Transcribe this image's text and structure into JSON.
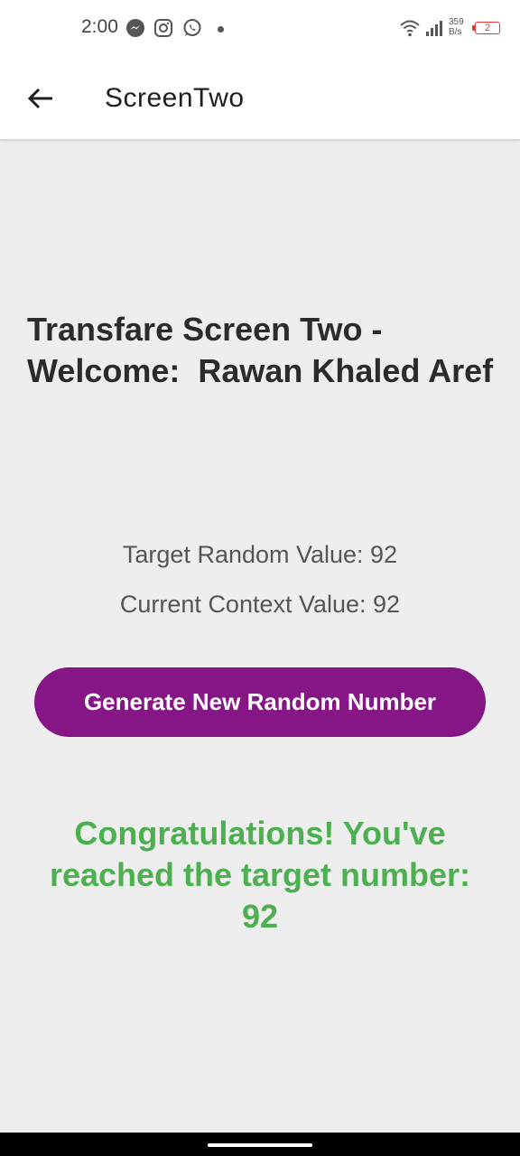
{
  "status_bar": {
    "time": "2:00",
    "net_speed_value": "359",
    "net_speed_unit": "B/s",
    "battery_level": "2",
    "icons": [
      "messenger-icon",
      "instagram-icon",
      "whatsapp-icon",
      "wifi-icon",
      "signal-icon",
      "battery-icon"
    ],
    "battery_color": "#e53935"
  },
  "app_bar": {
    "title": "ScreenTwo",
    "back_icon": "arrow-left-icon"
  },
  "main": {
    "welcome_line1": "Transfare Screen Two -",
    "welcome_line2": "Welcome:  Rawan Khaled Aref",
    "target_label": "Target Random Value: 92",
    "current_label": "Current Context Value: 92",
    "generate_button_label": "Generate New Random Number",
    "congrats_line1": "Congratulations! You've",
    "congrats_line2": "reached the target number:",
    "congrats_line3": "92"
  },
  "colors": {
    "accent": "#861586",
    "success": "#4caf50",
    "background": "#eeeeee"
  }
}
